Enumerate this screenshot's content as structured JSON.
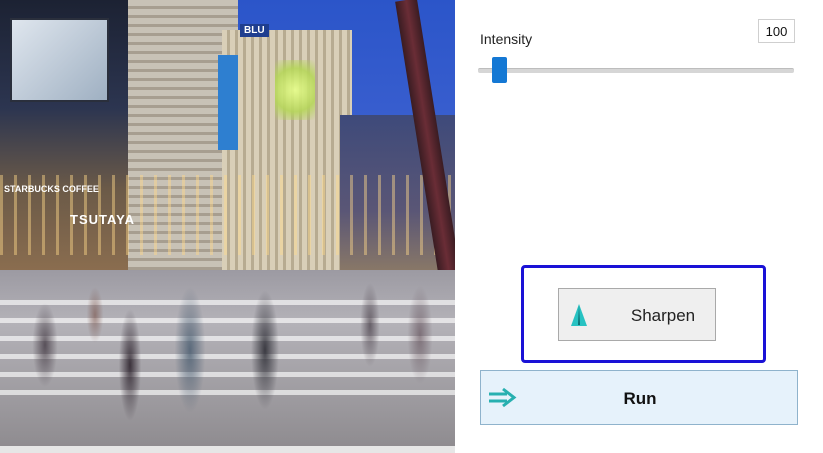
{
  "photo": {
    "signs": {
      "starbucks": "STARBUCKS COFFEE",
      "tsutaya": "TSUTAYA",
      "bldg": "BLU"
    }
  },
  "intensity": {
    "label": "Intensity",
    "value": "100"
  },
  "sharpen": {
    "label": "Sharpen",
    "icon": "sharpen-triangle-icon",
    "icon_color": "#27c2c2"
  },
  "run": {
    "label": "Run",
    "icon": "double-arrow-right-icon",
    "icon_color": "#27b0b0"
  },
  "colors": {
    "highlight": "#1a12d6",
    "slider_thumb": "#1478d4",
    "run_background": "#e6f2fb"
  }
}
